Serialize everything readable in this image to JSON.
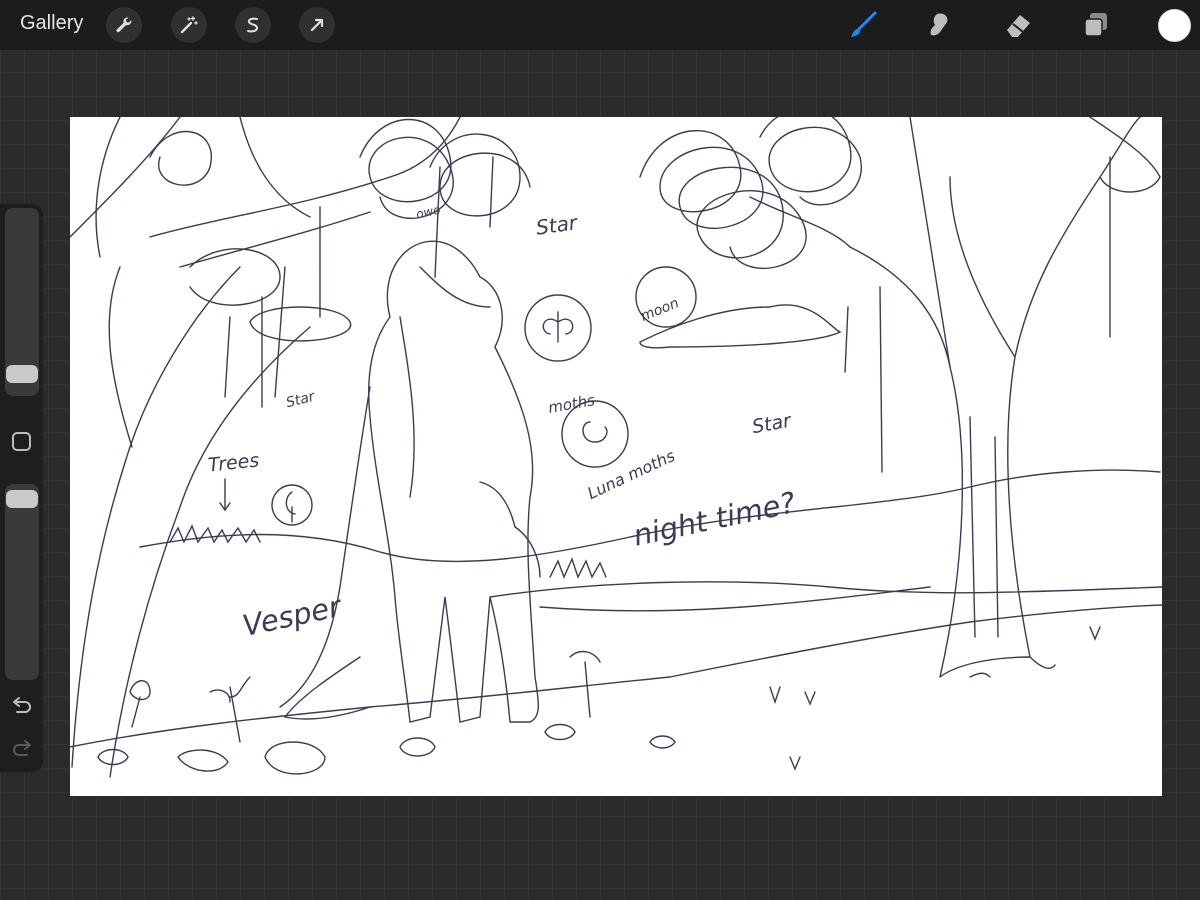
{
  "toolbar": {
    "gallery_label": "Gallery",
    "left_tools": [
      {
        "name": "actions",
        "icon": "wrench-icon"
      },
      {
        "name": "adjustments",
        "icon": "magic-wand-icon"
      },
      {
        "name": "selection",
        "icon": "selection-s-icon"
      },
      {
        "name": "transform",
        "icon": "arrow-cursor-icon"
      }
    ],
    "right_tools": [
      {
        "name": "brush",
        "icon": "brush-icon",
        "active": true
      },
      {
        "name": "smudge",
        "icon": "smudge-icon"
      },
      {
        "name": "eraser",
        "icon": "eraser-icon"
      },
      {
        "name": "layers",
        "icon": "layers-icon"
      }
    ],
    "current_color": "#ffffff",
    "active_color": "#1a8cff"
  },
  "sidebar": {
    "brush_size_icon": "brush-size-slider",
    "opacity_icon": "opacity-slider",
    "modify_icon": "square-modify-icon",
    "undo_icon": "undo-icon",
    "redo_icon": "redo-icon"
  },
  "canvas": {
    "labels": {
      "owo": "owo",
      "star_top": "Star",
      "moon": "moon",
      "star_left": "Star",
      "moths": "moths",
      "star_right": "Star",
      "trees": "Trees",
      "luna_moths": "Luna moths",
      "night_time": "night time?",
      "vesper": "Vesper"
    },
    "ink_color": "#3d3a55"
  }
}
